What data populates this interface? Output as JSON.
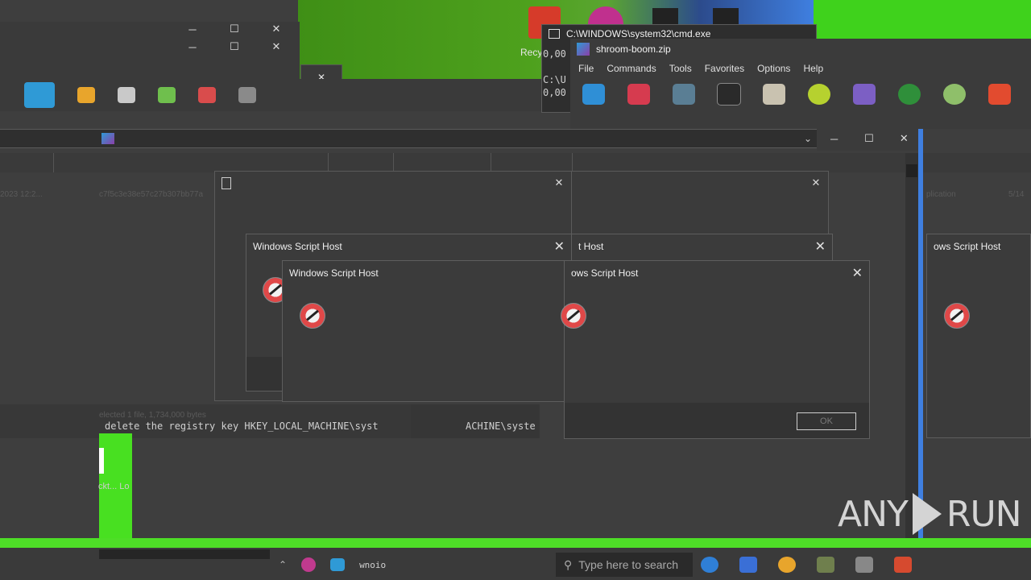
{
  "cmd_window": {
    "title": "C:\\WINDOWS\\system32\\cmd.exe",
    "lines": [
      "0,00",
      "C:\\U",
      "0,00"
    ],
    "recycle_label": "Recy"
  },
  "zip_window": {
    "title": "shroom-boom.zip",
    "menu": [
      "File",
      "Commands",
      "Tools",
      "Favorites",
      "Options",
      "Help"
    ]
  },
  "background_texts": {
    "date_fragment": "2023 12:2...",
    "hash_fragment": "c7f5c3e38e57c27b307bb77a",
    "application_fragment": "plication",
    "size_fragment": "5/14",
    "status_fragment": "elected 1 file, 1,734,000 bytes",
    "registry_line": "delete the registry key HKEY_LOCAL_MACHINE\\syst",
    "registry_line_right": "ACHINE\\syste",
    "left_fragment": "ckt...  Lo"
  },
  "dialogs": [
    {
      "title": "Windows Script Host"
    },
    {
      "title": "Windows Script Host"
    },
    {
      "title": "t Host"
    },
    {
      "title": "ows Script Host"
    },
    {
      "title": "ows Script Host"
    }
  ],
  "ok_label": "OK",
  "taskbar": {
    "search_placeholder": "Type here to search",
    "tray_text": "wnoio"
  },
  "watermark": {
    "left": "ANY",
    "right": "RUN"
  },
  "colors": {
    "accent_green": "#4ede27",
    "bg_dark": "#3c3c3c"
  }
}
